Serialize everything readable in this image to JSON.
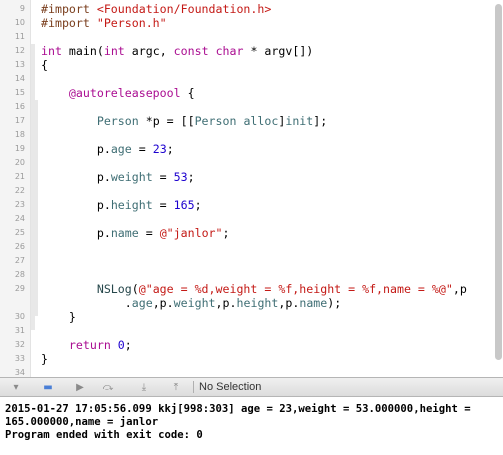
{
  "editor": {
    "lines": [
      {
        "num": "9",
        "tokens": [
          {
            "t": "#import ",
            "c": "directive"
          },
          {
            "t": "<Foundation/Foundation.h>",
            "c": "include"
          }
        ]
      },
      {
        "num": "10",
        "tokens": [
          {
            "t": "#import ",
            "c": "directive"
          },
          {
            "t": "\"Person.h\"",
            "c": "include"
          }
        ]
      },
      {
        "num": "11",
        "tokens": []
      },
      {
        "num": "12",
        "tokens": [
          {
            "t": "int",
            "c": "keyword"
          },
          {
            "t": " main(",
            "c": "plain"
          },
          {
            "t": "int",
            "c": "keyword"
          },
          {
            "t": " argc, ",
            "c": "plain"
          },
          {
            "t": "const",
            "c": "keyword"
          },
          {
            "t": " ",
            "c": "plain"
          },
          {
            "t": "char",
            "c": "keyword"
          },
          {
            "t": " * argv[])",
            "c": "plain"
          }
        ]
      },
      {
        "num": "13",
        "tokens": [
          {
            "t": "{",
            "c": "plain"
          }
        ]
      },
      {
        "num": "14",
        "tokens": []
      },
      {
        "num": "15",
        "tokens": [
          {
            "t": "    ",
            "c": "plain"
          },
          {
            "t": "@autoreleasepool",
            "c": "keyword"
          },
          {
            "t": " {",
            "c": "plain"
          }
        ]
      },
      {
        "num": "16",
        "tokens": []
      },
      {
        "num": "17",
        "tokens": [
          {
            "t": "        ",
            "c": "plain"
          },
          {
            "t": "Person",
            "c": "class"
          },
          {
            "t": " *p = [[",
            "c": "plain"
          },
          {
            "t": "Person",
            "c": "class"
          },
          {
            "t": " ",
            "c": "plain"
          },
          {
            "t": "alloc",
            "c": "class"
          },
          {
            "t": "]",
            "c": "plain"
          },
          {
            "t": "init",
            "c": "class"
          },
          {
            "t": "];",
            "c": "plain"
          }
        ]
      },
      {
        "num": "18",
        "tokens": []
      },
      {
        "num": "19",
        "tokens": [
          {
            "t": "        p.",
            "c": "plain"
          },
          {
            "t": "age",
            "c": "prop"
          },
          {
            "t": " = ",
            "c": "plain"
          },
          {
            "t": "23",
            "c": "number"
          },
          {
            "t": ";",
            "c": "plain"
          }
        ]
      },
      {
        "num": "20",
        "tokens": []
      },
      {
        "num": "21",
        "tokens": [
          {
            "t": "        p.",
            "c": "plain"
          },
          {
            "t": "weight",
            "c": "prop"
          },
          {
            "t": " = ",
            "c": "plain"
          },
          {
            "t": "53",
            "c": "number"
          },
          {
            "t": ";",
            "c": "plain"
          }
        ]
      },
      {
        "num": "22",
        "tokens": []
      },
      {
        "num": "23",
        "tokens": [
          {
            "t": "        p.",
            "c": "plain"
          },
          {
            "t": "height",
            "c": "prop"
          },
          {
            "t": " = ",
            "c": "plain"
          },
          {
            "t": "165",
            "c": "number"
          },
          {
            "t": ";",
            "c": "plain"
          }
        ]
      },
      {
        "num": "24",
        "tokens": []
      },
      {
        "num": "25",
        "tokens": [
          {
            "t": "        p.",
            "c": "plain"
          },
          {
            "t": "name",
            "c": "prop"
          },
          {
            "t": " = ",
            "c": "plain"
          },
          {
            "t": "@\"janlor\"",
            "c": "string"
          },
          {
            "t": ";",
            "c": "plain"
          }
        ]
      },
      {
        "num": "26",
        "tokens": []
      },
      {
        "num": "27",
        "tokens": []
      },
      {
        "num": "28",
        "tokens": []
      },
      {
        "num": "29",
        "tokens": [
          {
            "t": "        ",
            "c": "plain"
          },
          {
            "t": "NSLog",
            "c": "func"
          },
          {
            "t": "(",
            "c": "plain"
          },
          {
            "t": "@\"age = %d,weight = %f,height = %f,name = %@\"",
            "c": "string"
          },
          {
            "t": ",p",
            "c": "plain"
          }
        ]
      },
      {
        "num": "",
        "tokens": [
          {
            "t": "            .",
            "c": "plain"
          },
          {
            "t": "age",
            "c": "prop"
          },
          {
            "t": ",p.",
            "c": "plain"
          },
          {
            "t": "weight",
            "c": "prop"
          },
          {
            "t": ",p.",
            "c": "plain"
          },
          {
            "t": "height",
            "c": "prop"
          },
          {
            "t": ",p.",
            "c": "plain"
          },
          {
            "t": "name",
            "c": "prop"
          },
          {
            "t": ");",
            "c": "plain"
          }
        ]
      },
      {
        "num": "30",
        "tokens": [
          {
            "t": "    }",
            "c": "plain"
          }
        ]
      },
      {
        "num": "31",
        "tokens": []
      },
      {
        "num": "32",
        "tokens": [
          {
            "t": "    ",
            "c": "plain"
          },
          {
            "t": "return",
            "c": "keyword"
          },
          {
            "t": " ",
            "c": "plain"
          },
          {
            "t": "0",
            "c": "number"
          },
          {
            "t": ";",
            "c": "plain"
          }
        ]
      },
      {
        "num": "33",
        "tokens": [
          {
            "t": "}",
            "c": "plain"
          }
        ]
      },
      {
        "num": "34",
        "tokens": []
      }
    ]
  },
  "debug_bar": {
    "buttons": [
      {
        "name": "hide-debug-area-icon",
        "glyph": "▾"
      },
      {
        "name": "breakpoint-toggle-icon",
        "glyph": "▬"
      },
      {
        "name": "pause-continue-icon",
        "glyph": "▶"
      },
      {
        "name": "step-over-icon",
        "glyph": "⤼"
      },
      {
        "name": "step-into-icon",
        "glyph": "⤓"
      },
      {
        "name": "step-out-icon",
        "glyph": "⤒"
      }
    ],
    "selection_label": "No Selection"
  },
  "console": {
    "output": "2015-01-27 17:05:56.099 kkj[998:303] age = 23,weight = 53.000000,height =\n165.000000,name = janlor\nProgram ended with exit code: 0"
  },
  "colors": {
    "directive": "#7a3e1d",
    "include": "#c41a16",
    "keyword": "#aa0d91",
    "class": "#3f6e74",
    "number": "#1c00cf",
    "string": "#c41a16"
  }
}
